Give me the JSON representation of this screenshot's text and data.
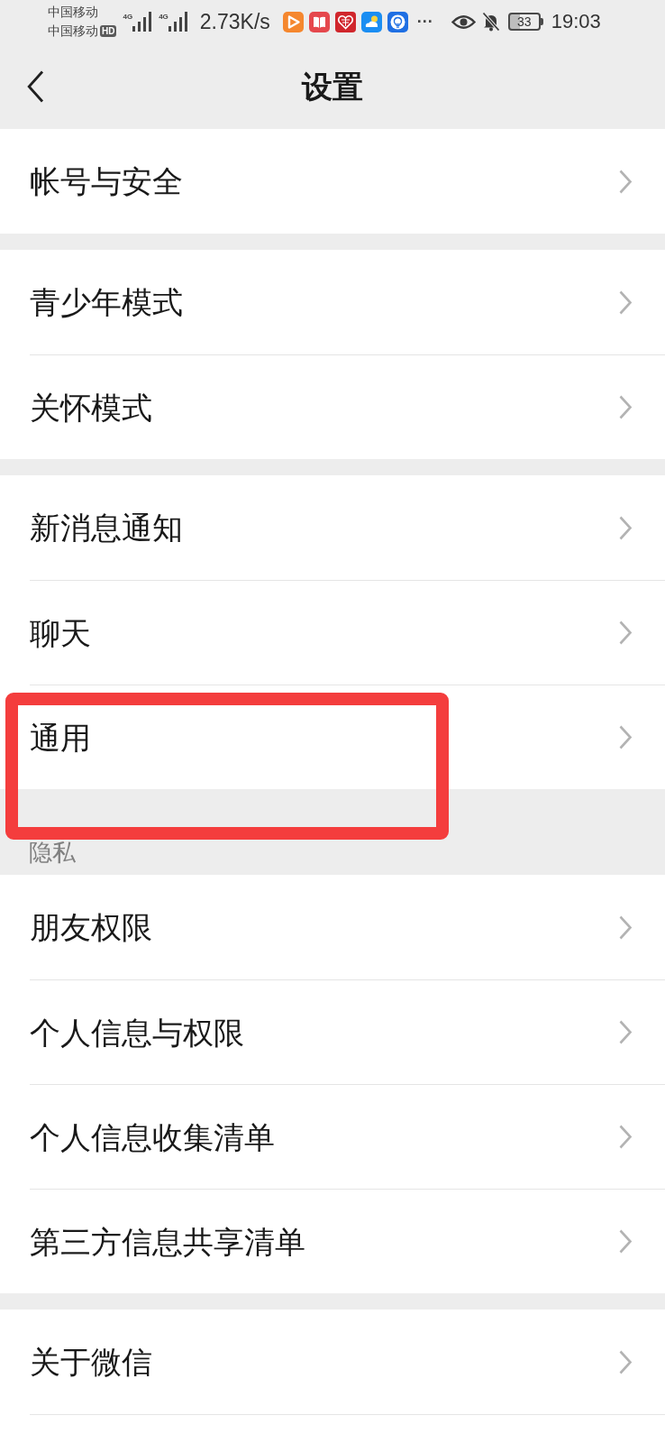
{
  "status_bar": {
    "carriers": [
      {
        "name": "中国移动"
      },
      {
        "name": "中国移动",
        "badge": "HD"
      }
    ],
    "signals": [
      {
        "network": "4G"
      },
      {
        "network": "4G"
      }
    ],
    "network_speed": "2.73K/s",
    "overflow": "···",
    "battery": "33",
    "time": "19:03"
  },
  "header": {
    "title": "设置"
  },
  "groups": [
    {
      "items": [
        {
          "label": "帐号与安全",
          "highlighted": false
        }
      ]
    },
    {
      "items": [
        {
          "label": "青少年模式",
          "highlighted": false
        },
        {
          "label": "关怀模式",
          "highlighted": false
        }
      ]
    },
    {
      "items": [
        {
          "label": "新消息通知",
          "highlighted": false
        },
        {
          "label": "聊天",
          "highlighted": false
        },
        {
          "label": "通用",
          "highlighted": true
        }
      ]
    },
    {
      "title": "隐私",
      "items": [
        {
          "label": "朋友权限",
          "highlighted": false
        },
        {
          "label": "个人信息与权限",
          "highlighted": false
        },
        {
          "label": "个人信息收集清单",
          "highlighted": false
        },
        {
          "label": "第三方信息共享清单",
          "highlighted": false
        }
      ]
    },
    {
      "items": [
        {
          "label": "关于微信",
          "highlighted": false
        }
      ]
    }
  ]
}
